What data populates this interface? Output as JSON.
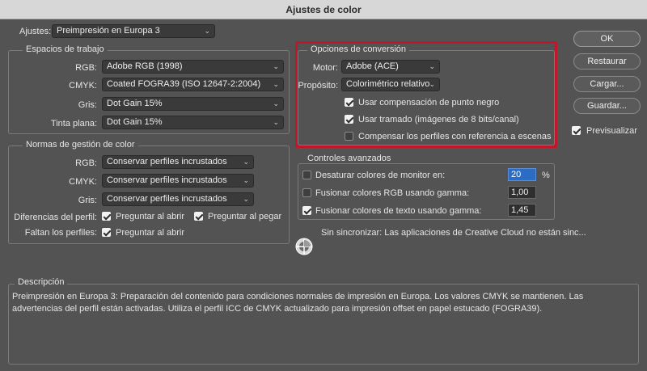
{
  "window": {
    "title": "Ajustes de color"
  },
  "ajustes": {
    "label": "Ajustes:",
    "value": "Preimpresión en Europa 3"
  },
  "espacios": {
    "title": "Espacios de trabajo",
    "rgb_label": "RGB:",
    "rgb_value": "Adobe RGB (1998)",
    "cmyk_label": "CMYK:",
    "cmyk_value": "Coated FOGRA39 (ISO 12647-2:2004)",
    "gris_label": "Gris:",
    "gris_value": "Dot Gain 15%",
    "tinta_label": "Tinta plana:",
    "tinta_value": "Dot Gain 15%"
  },
  "normas": {
    "title": "Normas de gestión de color",
    "rgb_label": "RGB:",
    "rgb_value": "Conservar perfiles incrustados",
    "cmyk_label": "CMYK:",
    "cmyk_value": "Conservar perfiles incrustados",
    "gris_label": "Gris:",
    "gris_value": "Conservar perfiles incrustados",
    "diferencias_label": "Diferencias del perfil:",
    "preguntar_abrir_1": "Preguntar al abrir",
    "preguntar_pegar": "Preguntar al pegar",
    "faltan_label": "Faltan los perfiles:",
    "preguntar_abrir_2": "Preguntar al abrir"
  },
  "conversion": {
    "title": "Opciones de conversión",
    "motor_label": "Motor:",
    "motor_value": "Adobe (ACE)",
    "proposito_label": "Propósito:",
    "proposito_value": "Colorimétrico relativo",
    "punto_negro": "Usar compensación de punto negro",
    "tramado": "Usar tramado (imágenes de 8 bits/canal)",
    "escenas": "Compensar los perfiles con referencia a escenas"
  },
  "avanzados": {
    "title": "Controles avanzados",
    "desaturar_label": "Desaturar colores de monitor en:",
    "desaturar_value": "20",
    "desaturar_unit": "%",
    "fusionar_rgb_label": "Fusionar colores RGB usando gamma:",
    "fusionar_rgb_value": "1,00",
    "fusionar_texto_label": "Fusionar colores de texto usando gamma:",
    "fusionar_texto_value": "1,45"
  },
  "sync": {
    "text": "Sin sincronizar: Las aplicaciones de Creative Cloud no están sinc..."
  },
  "buttons": {
    "ok": "OK",
    "restaurar": "Restaurar",
    "cargar": "Cargar...",
    "guardar": "Guardar...",
    "previsualizar": "Previsualizar"
  },
  "descripcion": {
    "title": "Descripción",
    "text": "Preimpresión en Europa 3:  Preparación del contenido para condiciones normales de impresión en Europa. Los valores CMYK se mantienen. Las advertencias del perfil están activadas. Utiliza el perfil ICC de CMYK actualizado para impresión offset en papel estucado (FOGRA39)."
  },
  "colors": {
    "highlight_box": "#c0182a",
    "field_selected": "#2b6cc4"
  }
}
